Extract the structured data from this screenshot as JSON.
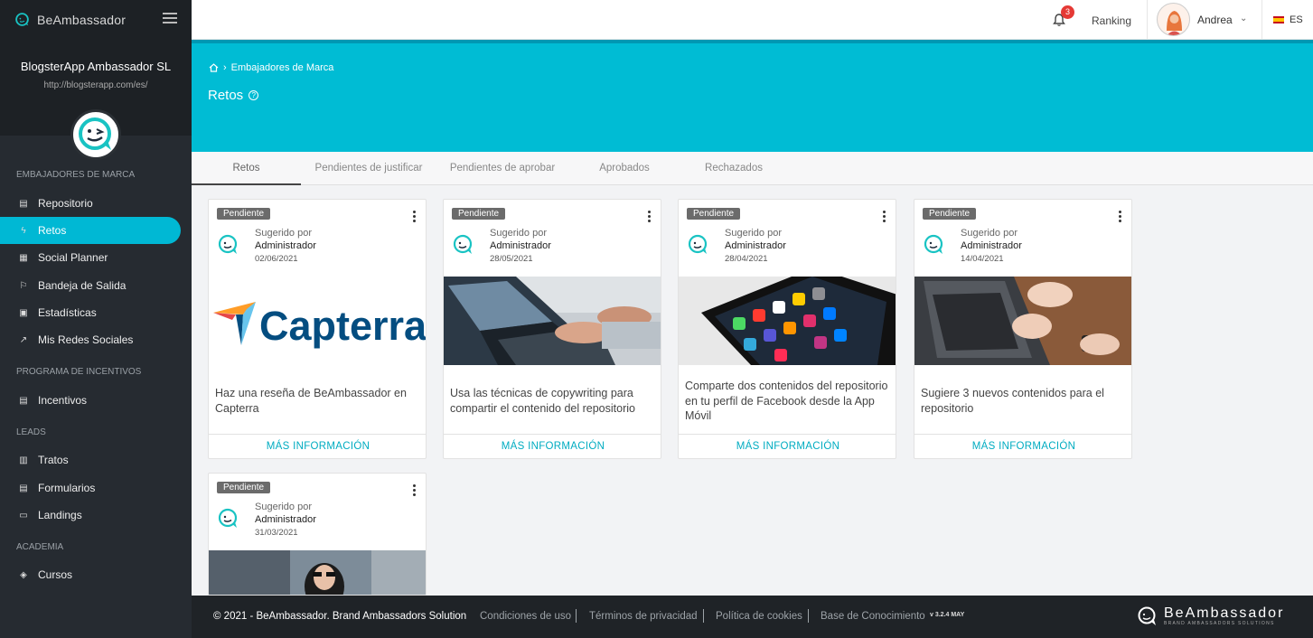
{
  "sidebar": {
    "brand": "BeAmbassador",
    "company": "BlogsterApp Ambassador SL",
    "url": "http://blogsterapp.com/es/",
    "sections": {
      "embajadores": "EMBAJADORES DE MARCA",
      "incentivos": "PROGRAMA DE INCENTIVOS",
      "leads": "LEADS",
      "academia": "ACADEMIA"
    },
    "items": {
      "repositorio": "Repositorio",
      "retos": "Retos",
      "social_planner": "Social Planner",
      "bandeja": "Bandeja de Salida",
      "estadisticas": "Estadísticas",
      "redes": "Mis Redes Sociales",
      "incentivos": "Incentivos",
      "tratos": "Tratos",
      "formularios": "Formularios",
      "landings": "Landings",
      "cursos": "Cursos"
    }
  },
  "topbar": {
    "notifications": "3",
    "ranking": "Ranking",
    "user": "Andrea",
    "lang": "ES"
  },
  "hero": {
    "breadcrumb": "Embajadores de Marca",
    "title": "Retos"
  },
  "tabs": {
    "retos": "Retos",
    "justificar": "Pendientes de justificar",
    "aprobar": "Pendientes de aprobar",
    "aprobados": "Aprobados",
    "rechazados": "Rechazados"
  },
  "cards": [
    {
      "status": "Pendiente",
      "suggested": "Sugerido por",
      "author": "Administrador",
      "date": "02/06/2021",
      "image_text": "Capterra",
      "text": "Haz una reseña de BeAmbassador en Capterra",
      "button": "MÁS INFORMACIÓN"
    },
    {
      "status": "Pendiente",
      "suggested": "Sugerido por",
      "author": "Administrador",
      "date": "28/05/2021",
      "text": "Usa las técnicas de copywriting para compartir el contenido del repositorio",
      "button": "MÁS INFORMACIÓN"
    },
    {
      "status": "Pendiente",
      "suggested": "Sugerido por",
      "author": "Administrador",
      "date": "28/04/2021",
      "text": "Comparte dos contenidos del repositorio en tu perfil de Facebook desde la App Móvil",
      "button": "MÁS INFORMACIÓN"
    },
    {
      "status": "Pendiente",
      "suggested": "Sugerido por",
      "author": "Administrador",
      "date": "14/04/2021",
      "text": "Sugiere 3 nuevos contenidos para el repositorio",
      "button": "MÁS INFORMACIÓN"
    },
    {
      "status": "Pendiente",
      "suggested": "Sugerido por",
      "author": "Administrador",
      "date": "31/03/2021"
    }
  ],
  "footer": {
    "copyright": "© 2021 - BeAmbassador. Brand Ambassadors Solution",
    "links": [
      "Condiciones de uso",
      "Términos de privacidad",
      "Política de cookies",
      "Base de Conocimiento"
    ],
    "version": "v 3.2.4 MAY",
    "logo_name": "BeAmbassador",
    "logo_sub": "BRAND AMBASSADORS SOLUTIONS"
  },
  "colors": {
    "accent": "#00bcd4",
    "sidebar": "#262b31",
    "footer": "#1f2327",
    "badge": "#6b6b6b"
  }
}
